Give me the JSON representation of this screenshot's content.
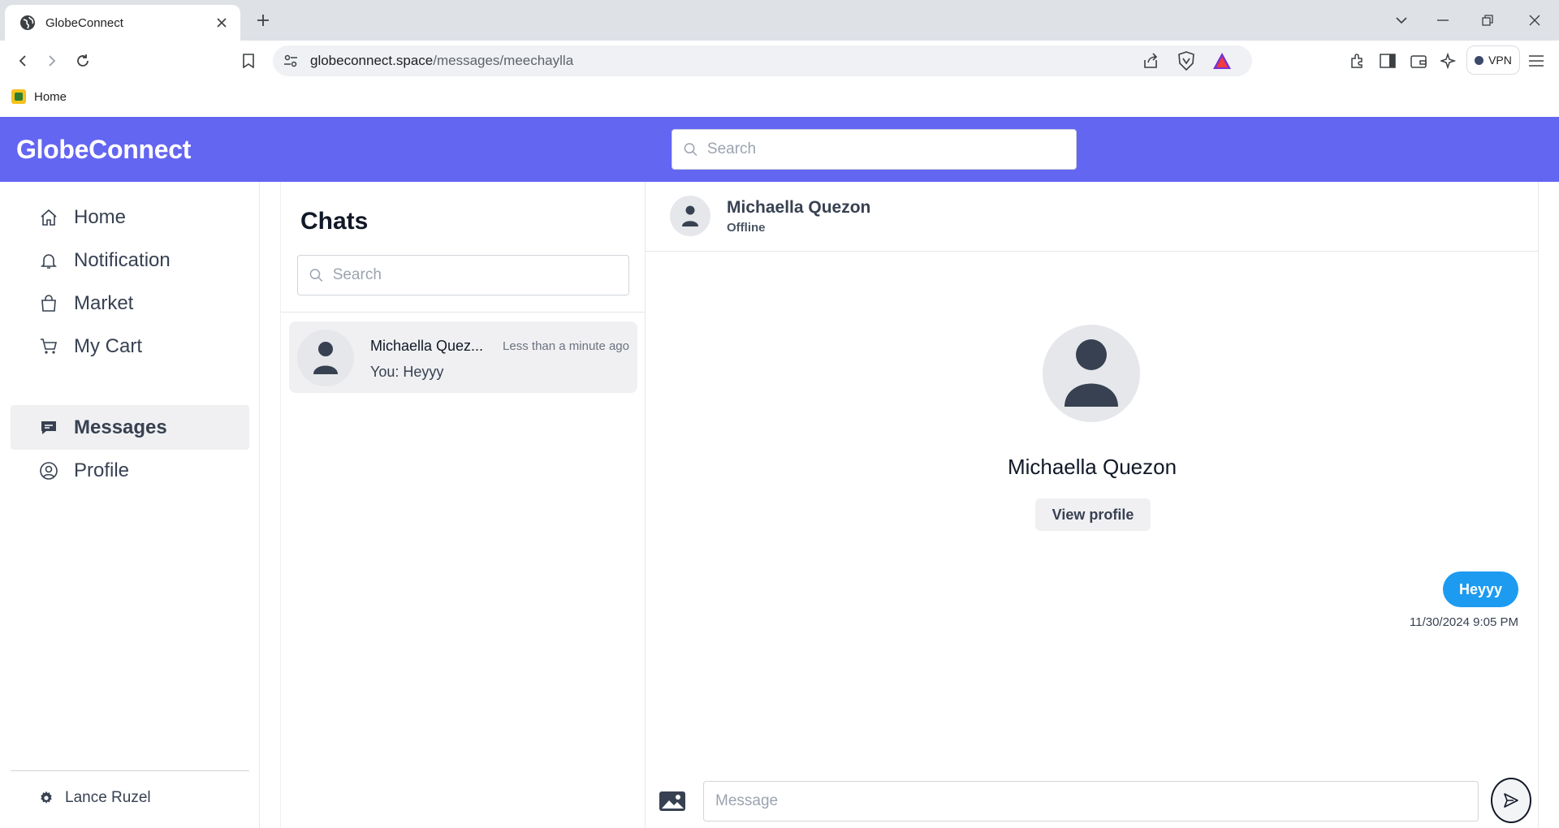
{
  "browser": {
    "tab_title": "GlobeConnect",
    "url_host": "globeconnect.space",
    "url_path": "/messages/meechaylla",
    "vpn_label": "VPN",
    "bookmark_label": "Home"
  },
  "app": {
    "brand": "GlobeConnect",
    "search_placeholder": "Search",
    "accent_color": "#6366f1"
  },
  "nav": {
    "items": [
      {
        "label": "Home",
        "icon": "home-icon"
      },
      {
        "label": "Notification",
        "icon": "bell-icon"
      },
      {
        "label": "Market",
        "icon": "shopping-bag-icon"
      },
      {
        "label": "My Cart",
        "icon": "cart-icon"
      },
      {
        "label": "Messages",
        "icon": "chat-bubble-icon",
        "active": true
      },
      {
        "label": "Profile",
        "icon": "user-circle-icon"
      }
    ],
    "user_name": "Lance Ruzel"
  },
  "chats": {
    "title": "Chats",
    "search_placeholder": "Search",
    "conversations": [
      {
        "name": "Michaella Quez...",
        "time": "Less than a minute ago",
        "preview": "You: Heyyy"
      }
    ]
  },
  "conversation": {
    "name": "Michaella Quezon",
    "status": "Offline",
    "profile_name": "Michaella Quezon",
    "view_profile_label": "View profile",
    "messages": [
      {
        "text": "Heyyy",
        "timestamp": "11/30/2024 9:05 PM",
        "from_me": true
      }
    ],
    "composer_placeholder": "Message",
    "bubble_color": "#1d9bf0"
  }
}
